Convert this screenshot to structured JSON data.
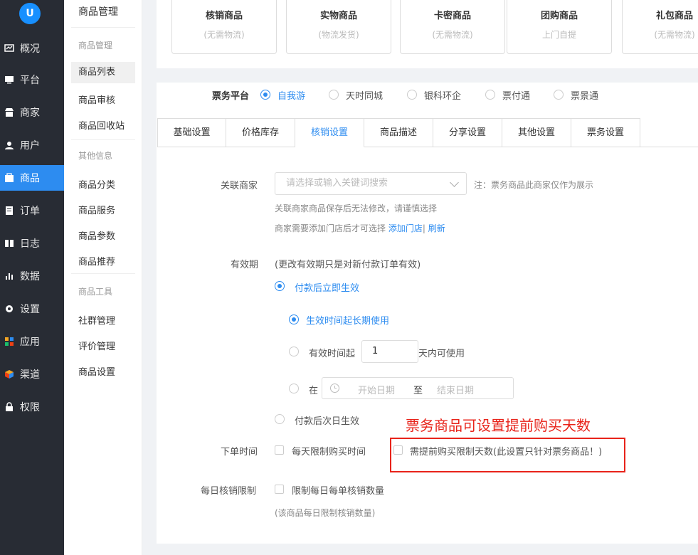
{
  "app": {
    "logo_text": "U"
  },
  "nav": [
    {
      "label": "概况",
      "icon": "dashboard-icon"
    },
    {
      "label": "平台",
      "icon": "monitor-icon"
    },
    {
      "label": "商家",
      "icon": "store-icon"
    },
    {
      "label": "用户",
      "icon": "user-icon"
    },
    {
      "label": "商品",
      "icon": "goods-icon",
      "active": true
    },
    {
      "label": "订单",
      "icon": "order-icon"
    },
    {
      "label": "日志",
      "icon": "log-icon"
    },
    {
      "label": "数据",
      "icon": "chart-icon"
    },
    {
      "label": "设置",
      "icon": "gear-icon"
    },
    {
      "label": "应用",
      "icon": "apps-icon"
    },
    {
      "label": "渠道",
      "icon": "channel-icon"
    },
    {
      "label": "权限",
      "icon": "lock-icon"
    }
  ],
  "subnav": {
    "title": "商品管理",
    "group1": "商品管理",
    "items1": [
      "商品列表",
      "商品审核",
      "商品回收站"
    ],
    "group2": "其他信息",
    "items2": [
      "商品分类",
      "商品服务",
      "商品参数",
      "商品推荐"
    ],
    "group3": "商品工具",
    "items3": [
      "社群管理",
      "评价管理",
      "商品设置"
    ]
  },
  "types": [
    {
      "title": "核销商品",
      "sub": "(无需物流)"
    },
    {
      "title": "实物商品",
      "sub": "(物流发货)"
    },
    {
      "title": "卡密商品",
      "sub": "(无需物流)"
    },
    {
      "title": "团购商品",
      "sub": "上门自提"
    },
    {
      "title": "礼包商品",
      "sub": "(无需物流)"
    }
  ],
  "platform": {
    "label": "票务平台",
    "options": [
      "自我游",
      "天时同城",
      "银科环企",
      "票付通",
      "票景通"
    ],
    "selected": 0
  },
  "tabs": [
    "基础设置",
    "价格库存",
    "核销设置",
    "商品描述",
    "分享设置",
    "其他设置",
    "票务设置"
  ],
  "active_tab": 2,
  "merchant": {
    "label": "关联商家",
    "placeholder": "请选择或输入关键词搜索",
    "note": "注：票务商品此商家仅作为展示",
    "hint1": "关联商家商品保存后无法修改，请谨慎选择",
    "hint2_prefix": "商家需要添加门店后才可选择",
    "hint2_link1": "添加门店",
    "hint2_sep": "|",
    "hint2_link2": "刷新"
  },
  "validity": {
    "label": "有效期",
    "desc": "(更改有效期只是对新付款订单有效)",
    "opt_immediate": "付款后立即生效",
    "opt_long": "生效时间起长期使用",
    "opt_days_prefix": "有效时间起",
    "days_value": "1",
    "opt_days_suffix": "天内可使用",
    "opt_range_prefix": "在",
    "start_placeholder": "开始日期",
    "range_sep": "至",
    "end_placeholder": "结束日期",
    "opt_next_day": "付款后次日生效"
  },
  "order_time": {
    "label": "下单时间",
    "opt_daily": "每天限制购买时间",
    "opt_advance": "需提前购买限制天数(此设置只针对票务商品！)"
  },
  "daily_verify": {
    "label": "每日核销限制",
    "opt": "限制每日每单核销数量",
    "hint": "(该商品每日限制核销数量)"
  },
  "annotation": "票务商品可设置提前购买天数",
  "colors": {
    "accent": "#2d8cf0",
    "sidebar": "#282c34",
    "annotation": "#e8231a"
  }
}
